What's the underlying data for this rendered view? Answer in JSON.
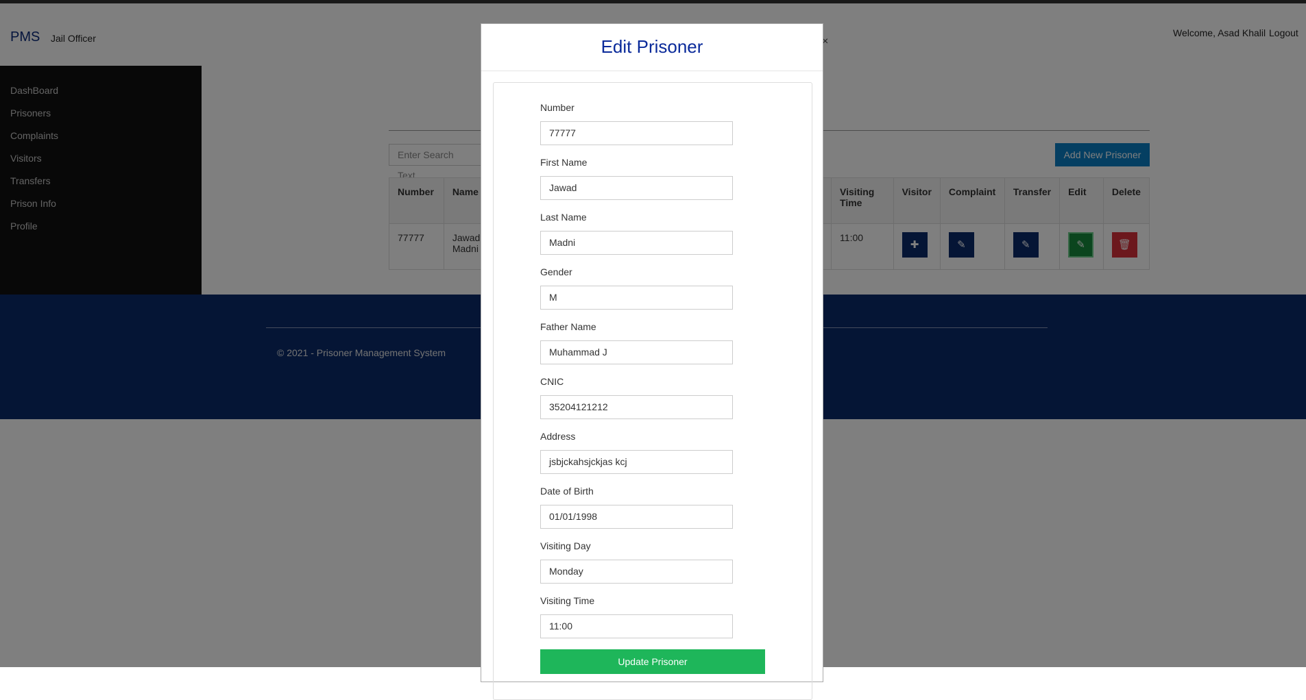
{
  "navbar": {
    "brand": "PMS",
    "role": "Jail Officer",
    "welcome": "Welcome, Asad Khalil",
    "logout": "Logout"
  },
  "sidebar": {
    "items": [
      {
        "label": "DashBoard"
      },
      {
        "label": "Prisoners"
      },
      {
        "label": "Complaints"
      },
      {
        "label": "Visitors"
      },
      {
        "label": "Transfers"
      },
      {
        "label": "Prison Info"
      },
      {
        "label": "Profile"
      }
    ]
  },
  "main": {
    "search_placeholder": "Enter Search Text..",
    "add_button": "Add New Prisoner",
    "table": {
      "headers": [
        "Number",
        "Name",
        "Visiting Time",
        "Visitor",
        "Complaint",
        "Transfer",
        "Edit",
        "Delete"
      ],
      "row": {
        "number": "77777",
        "name_first": "Jawad",
        "name_last": "Madni",
        "visiting_time": "11:00"
      }
    }
  },
  "footer": {
    "text": "© 2021 - Prisoner Management System"
  },
  "modal": {
    "title": "Edit Prisoner",
    "close": "×",
    "fields": [
      {
        "label": "Number",
        "value": "77777"
      },
      {
        "label": "First Name",
        "value": "Jawad"
      },
      {
        "label": "Last Name",
        "value": "Madni"
      },
      {
        "label": "Gender",
        "value": "M"
      },
      {
        "label": "Father Name",
        "value": "Muhammad J"
      },
      {
        "label": "CNIC",
        "value": "35204121212"
      },
      {
        "label": "Address",
        "value": "jsbjckahsjckjas kcj"
      },
      {
        "label": "Date of Birth",
        "value": "01/01/1998"
      },
      {
        "label": "Visiting Day",
        "value": "Monday"
      },
      {
        "label": "Visiting Time",
        "value": "11:00"
      }
    ],
    "submit": "Update Prisoner"
  },
  "colors": {
    "brand_navy": "#0a2a6a",
    "accent_blue": "#0b7fc4",
    "success_green": "#1eb65a",
    "danger_red": "#d9303a"
  },
  "icons": {
    "visitor": "plus-icon",
    "complaint": "edit-icon",
    "transfer": "edit-icon",
    "edit": "edit-icon",
    "delete": "trash-icon"
  }
}
